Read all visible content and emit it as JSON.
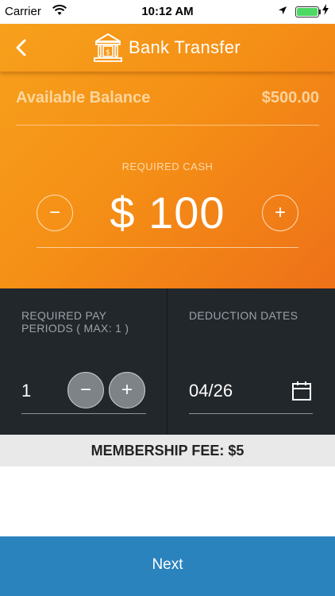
{
  "status_bar": {
    "carrier": "Carrier",
    "time": "10:12 AM",
    "battery_color": "#4cd964"
  },
  "header": {
    "title": "Bank Transfer",
    "back_icon": "chevron-left-icon",
    "title_icon": "bank-icon"
  },
  "balance": {
    "label": "Available Balance",
    "value": "$500.00"
  },
  "cash": {
    "label": "REQUIRED CASH",
    "amount": "$ 100",
    "decrement_symbol": "−",
    "increment_symbol": "+"
  },
  "pay_periods": {
    "label": "REQUIRED PAY PERIODS ( MAX: 1 )",
    "value": "1",
    "decrement_symbol": "−",
    "increment_symbol": "+"
  },
  "deduction": {
    "label": "DEDUCTION DATES",
    "value": "04/26",
    "icon": "calendar-icon"
  },
  "membership_fee": "MEMBERSHIP FEE: $5",
  "next_button": "Next",
  "colors": {
    "orange_start": "#f7a01c",
    "orange_end": "#ee7118",
    "dark_panel": "#22272b",
    "next_blue": "#2a83bd"
  }
}
